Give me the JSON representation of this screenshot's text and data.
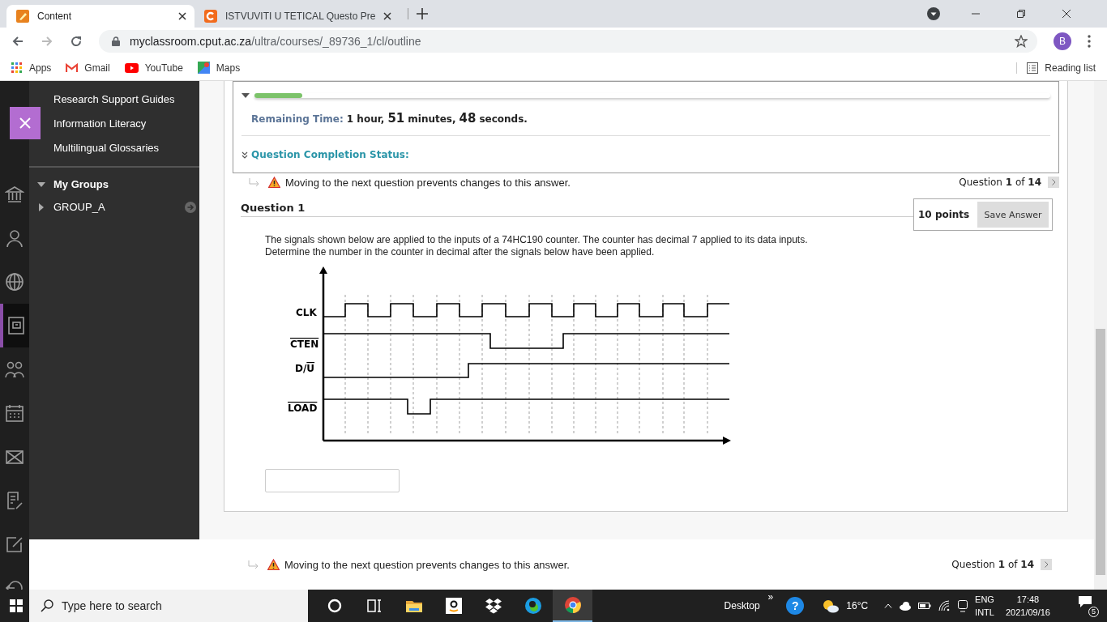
{
  "browser": {
    "tabs": [
      {
        "title": "Content",
        "selected": true
      },
      {
        "title": "ISTVUVITI U TETICAL Questo Pre",
        "selected": false
      }
    ],
    "url_host": "myclassroom.cput.ac.za",
    "url_path": "/ultra/courses/_89736_1/cl/outline",
    "profile": "B",
    "bookmarks": [
      {
        "label": "Apps"
      },
      {
        "label": "Gmail"
      },
      {
        "label": "YouTube"
      },
      {
        "label": "Maps"
      }
    ],
    "reading_list": "Reading list"
  },
  "rail": [
    {
      "kind": "institution",
      "selected": false
    },
    {
      "kind": "person",
      "selected": false
    },
    {
      "kind": "globe",
      "selected": false
    },
    {
      "kind": "courses",
      "selected": true
    },
    {
      "kind": "groups",
      "selected": false
    },
    {
      "kind": "calendar",
      "selected": false
    },
    {
      "kind": "mail",
      "selected": false
    },
    {
      "kind": "grades",
      "selected": false
    },
    {
      "kind": "edit",
      "selected": false
    },
    {
      "kind": "logout",
      "selected": false
    }
  ],
  "sidebar": {
    "links": [
      "Research Support Guides",
      "Information Literacy",
      "Multilingual Glossaries"
    ],
    "groups_heading": "My Groups",
    "groups_expanded": true,
    "groups": [
      {
        "name": "GROUP_A",
        "expanded": false
      }
    ]
  },
  "timer": {
    "progress": {
      "level": 0.06
    },
    "label": "Remaining Time:",
    "parts": [
      {
        "text": "1 hour,",
        "kind": "unit"
      },
      {
        "text": "51",
        "kind": "number"
      },
      {
        "text": "minutes,",
        "kind": "unit"
      },
      {
        "text": "48",
        "kind": "number"
      },
      {
        "text": "seconds.",
        "kind": "unit"
      }
    ],
    "completion_label": "Question Completion Status:",
    "completion_expanded": false
  },
  "top_warning": "Moving to the next question prevents changes to this answer.",
  "top_nav": "Question **1** of **14**",
  "question": {
    "title": "Question 1",
    "points": "10 points",
    "save": "Save Answer",
    "prompt_lines": [
      "The signals shown below are applied to the inputs of a 74HC190 counter. The counter has decimal 7 applied to its data inputs.",
      "Determine the number in the counter in decimal after the signals below have been applied."
    ],
    "signals": [
      {
        "parts": [
          {
            "text": "CLK",
            "overline": false
          }
        ]
      },
      {
        "parts": [
          {
            "text": "CTEN",
            "overline": true
          }
        ]
      },
      {
        "parts": [
          {
            "text": "D/",
            "overline": false
          },
          {
            "text": "U",
            "overline": true
          }
        ]
      },
      {
        "parts": [
          {
            "text": "LOAD",
            "overline": true
          }
        ]
      }
    ]
  },
  "bottom_warning": "Moving to the next question prevents changes to this answer.",
  "bottom_nav": "Question **1** of **14**",
  "taskbar": {
    "search_placeholder": "Type here to search",
    "desktop": "Desktop",
    "overflow": "»",
    "help": "?",
    "temperature": "16°C",
    "lang_1": "ENG",
    "lang_2": "INTL",
    "time": "17:48",
    "date": "2021/09/16",
    "notifications": "5",
    "apps": [
      {
        "kind": "cortana",
        "active": false
      },
      {
        "kind": "taskview",
        "active": false
      },
      {
        "kind": "folder",
        "active": false
      },
      {
        "kind": "amazon",
        "active": false
      },
      {
        "kind": "dropbox",
        "active": false
      },
      {
        "kind": "edge",
        "active": false
      },
      {
        "kind": "chrome",
        "active": true
      }
    ]
  }
}
